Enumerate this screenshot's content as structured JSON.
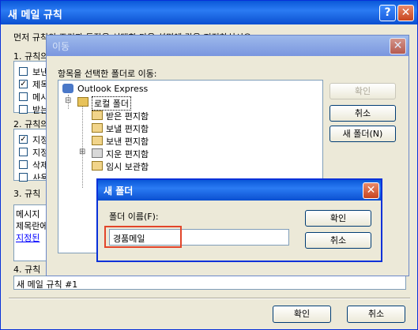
{
  "outer": {
    "title": "새 메일 규칙",
    "help_glyph": "?",
    "close_glyph": "✕",
    "intro": "먼저 규칙의 조건과 동작을 선택한 다음 설명에 값을 지정하십시오.",
    "section1": "1. 규칙의",
    "section1_items": [
      {
        "text": "보낸",
        "checked": false
      },
      {
        "text": "제목",
        "checked": true
      },
      {
        "text": "메시",
        "checked": false
      },
      {
        "text": "받는",
        "checked": false
      }
    ],
    "section2": "2. 규칙의",
    "section2_items": [
      {
        "text": "지정",
        "checked": true
      },
      {
        "text": "지정",
        "checked": false
      },
      {
        "text": "삭제",
        "checked": false
      },
      {
        "text": "사용",
        "checked": false
      }
    ],
    "section3": "3. 규칙",
    "desc_lines": [
      "메시지",
      "제목란에",
      "지정된"
    ],
    "section4": "4. 규칙",
    "rule_name": "새 메일 규칙 #1",
    "ok": "확인",
    "cancel": "취소"
  },
  "move_dialog": {
    "title": "이동",
    "close_glyph": "✕",
    "prompt": "항목을 선택한 폴더로 이동:",
    "tree": {
      "root": "Outlook Express",
      "local": "로컬 폴더",
      "folders": [
        "받은 편지함",
        "보낼 편지함",
        "보낸 편지함",
        "지운 편지함",
        "임시 보관함"
      ]
    },
    "ok": "확인",
    "cancel": "취소",
    "new_folder": "새 폴더(N)",
    "expand_glyph": "⊟",
    "collapse_glyph": "⊞"
  },
  "new_folder_dialog": {
    "title": "새 폴더",
    "close_glyph": "✕",
    "label": "폴더 이름(F):",
    "value": "경품메일",
    "ok": "확인",
    "cancel": "취소",
    "highlight_color": "#e2452a"
  }
}
